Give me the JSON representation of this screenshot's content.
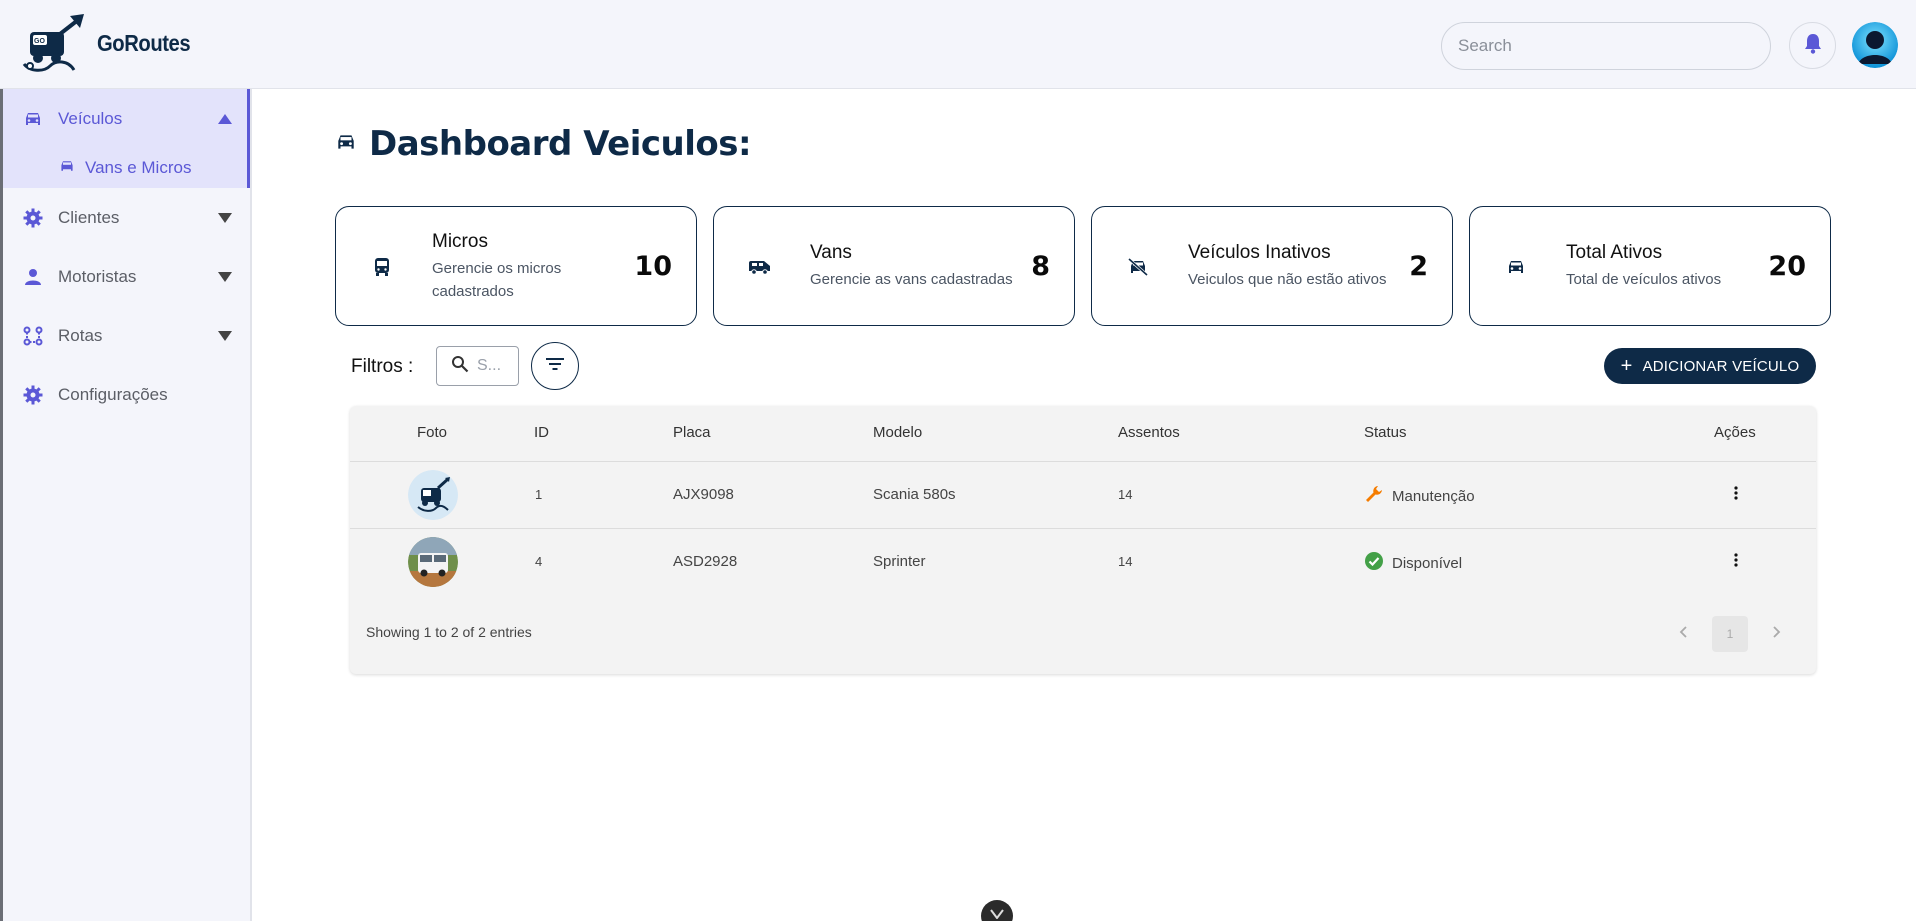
{
  "app": {
    "name": "GoRoutes"
  },
  "header": {
    "search_placeholder": "Search"
  },
  "sidebar": {
    "items": [
      {
        "label": "Veículos",
        "icon": "car-icon",
        "expanded": true,
        "children": [
          {
            "label": "Vans e Micros",
            "icon": "car-icon"
          }
        ]
      },
      {
        "label": "Clientes",
        "icon": "gear-icon"
      },
      {
        "label": "Motoristas",
        "icon": "person-icon"
      },
      {
        "label": "Rotas",
        "icon": "route-icon"
      },
      {
        "label": "Configurações",
        "icon": "gear-icon"
      }
    ]
  },
  "main": {
    "title": "Dashboard Veiculos:",
    "cards": [
      {
        "title": "Micros",
        "subtitle": "Gerencie os micros cadastrados",
        "count": "10",
        "icon": "bus-icon"
      },
      {
        "title": "Vans",
        "subtitle": "Gerencie as vans cadastradas",
        "count": "8",
        "icon": "van-icon"
      },
      {
        "title": "Veículos Inativos",
        "subtitle": "Veiculos que não estão ativos",
        "count": "2",
        "icon": "no-car-icon"
      },
      {
        "title": "Total Ativos",
        "subtitle": "Total de veículos ativos",
        "count": "20",
        "icon": "car-icon"
      }
    ],
    "filters": {
      "label": "Filtros :",
      "search_placeholder": "S..."
    },
    "add_button": "ADICIONAR VEÍCULO",
    "table": {
      "columns": [
        "Foto",
        "ID",
        "Placa",
        "Modelo",
        "Assentos",
        "Status",
        "Ações"
      ],
      "rows": [
        {
          "id": "1",
          "placa": "AJX9098",
          "modelo": "Scania 580s",
          "assentos": "14",
          "status": "Manutenção",
          "status_icon": "wrench-icon",
          "status_color": "#f57c00"
        },
        {
          "id": "4",
          "placa": "ASD2928",
          "modelo": "Sprinter",
          "assentos": "14",
          "status": "Disponível",
          "status_icon": "check-circle-icon",
          "status_color": "#43a047"
        }
      ],
      "footer": "Showing 1 to 2 of 2 entries",
      "current_page": "1"
    }
  },
  "colors": {
    "accent": "#5b58d6",
    "brand_dark": "#0e2a47",
    "header_bg": "#f4f5fb"
  }
}
